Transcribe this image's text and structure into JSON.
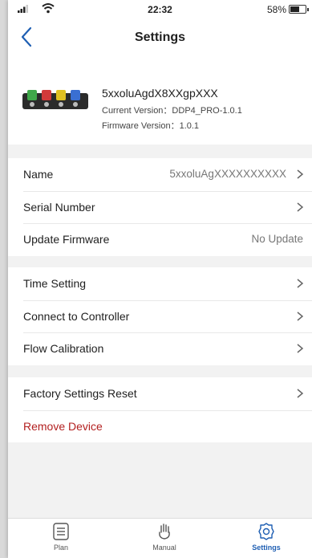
{
  "status_bar": {
    "time": "22:32",
    "battery": "58%"
  },
  "nav": {
    "title": "Settings"
  },
  "device": {
    "name": "5xxoluAgdX8XXgpXXX",
    "current_version": "Current Version：DDP4_PRO-1.0.1",
    "firmware_version": "Firmware Version：1.0.1"
  },
  "sections": {
    "info": {
      "name_label": "Name",
      "name_value": "5xxoluAgXXXXXXXXXX",
      "serial_label": "Serial Number",
      "update_label": "Update Firmware",
      "update_value": "No Update"
    },
    "controls": {
      "time_label": "Time Setting",
      "connect_label": "Connect to Controller",
      "flow_label": "Flow Calibration"
    },
    "danger": {
      "reset_label": "Factory Settings Reset",
      "remove_label": "Remove Device"
    }
  },
  "tabs": {
    "plan": "Plan",
    "manual": "Manual",
    "settings": "Settings"
  },
  "colors": {
    "accent": "#1f5fb3",
    "danger": "#b32020",
    "background": "#f2f2f2"
  }
}
